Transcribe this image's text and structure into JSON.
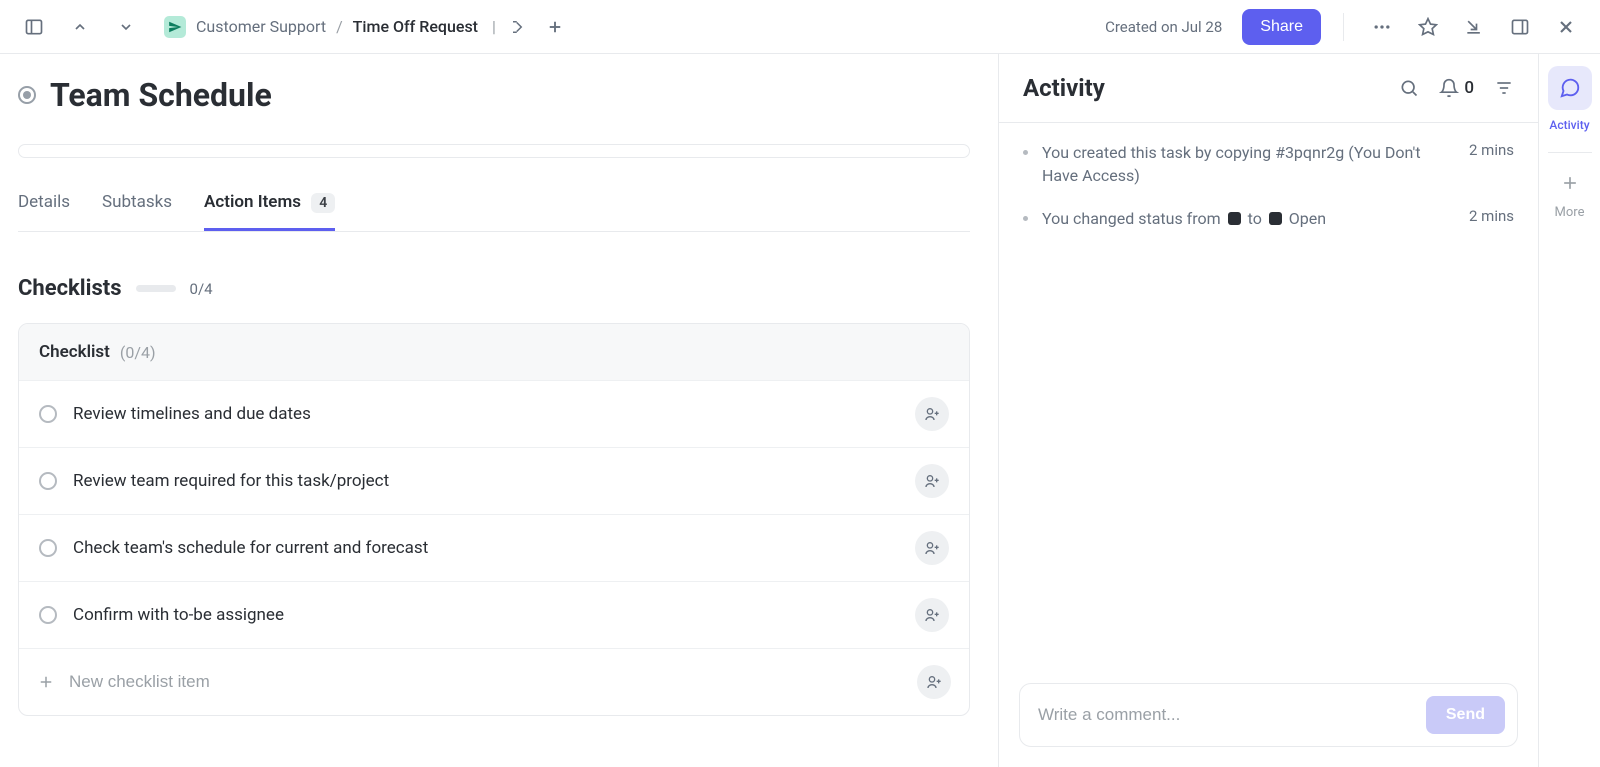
{
  "topbar": {
    "breadcrumb_space": "Customer Support",
    "breadcrumb_current": "Time Off Request",
    "created_on": "Created on Jul 28",
    "share_label": "Share"
  },
  "page": {
    "title": "Team Schedule"
  },
  "tabs": {
    "details": "Details",
    "subtasks": "Subtasks",
    "action_items": "Action Items",
    "action_items_badge": "4"
  },
  "checklists": {
    "title": "Checklists",
    "overall_progress": "0/4",
    "group_name": "Checklist",
    "group_count": "(0/4)",
    "items": [
      "Review timelines and due dates",
      "Review team required for this task/project",
      "Check team's schedule for current and forecast",
      "Confirm with to-be assignee"
    ],
    "add_placeholder": "New checklist item"
  },
  "activity": {
    "title": "Activity",
    "notif_count": "0",
    "feed": [
      {
        "text_pre": "You created this task by copying #3pqnr2g (You Don't Have Access)",
        "time": "2 mins",
        "type": "plain"
      },
      {
        "text_pre": "You changed status from ",
        "text_mid": " to ",
        "text_post": " Open",
        "time": "2 mins",
        "type": "status"
      }
    ],
    "comment_placeholder": "Write a comment...",
    "send_label": "Send"
  },
  "rail": {
    "activity_label": "Activity",
    "more_label": "More"
  }
}
